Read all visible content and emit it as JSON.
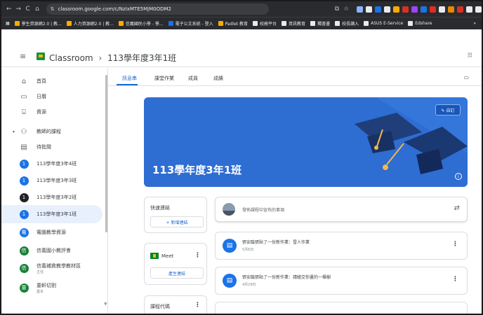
{
  "browser": {
    "url": "classroom.google.com/c/NzIxMTE5MjM0ODM2",
    "nav": {
      "back": "←",
      "forward": "→",
      "reload": "C",
      "home": "⌂",
      "tune": "⇅"
    },
    "star": "☆",
    "screenshot": "⧉",
    "bookmarks": [
      {
        "label": "學生資源網2.0 | 教...",
        "color": "#f9ab00"
      },
      {
        "label": "人力資源網2.0 | 教...",
        "color": "#f9ab00"
      },
      {
        "label": "信義國民小學 - 學...",
        "color": "#f9ab00"
      },
      {
        "label": "電子公文系統 - 登入",
        "color": "#1a73e8"
      },
      {
        "label": "Padlet 教育",
        "color": "#f9ab00"
      },
      {
        "label": "校務平台",
        "color": "#e8eaed"
      },
      {
        "label": "資訊教育",
        "color": "#e8eaed"
      },
      {
        "label": "獨書畫",
        "color": "#e8eaed"
      },
      {
        "label": "校長讀入",
        "color": "#e8eaed"
      },
      {
        "label": "ASUS E-Service",
        "color": "#e8eaed"
      },
      {
        "label": "Edshare",
        "color": "#e8eaed"
      }
    ],
    "more": "»",
    "extension_colors": [
      "#8ab4f8",
      "#e8eaed",
      "#1a73e8",
      "#e8eaed",
      "#f9ab00",
      "#d93025",
      "#a142f4",
      "#1a73e8",
      "#d93025",
      "#e8eaed",
      "#ea8600",
      "#d93025",
      "#e8eaed",
      "#e8eaed"
    ]
  },
  "header": {
    "app_name": "Classroom",
    "separator": "›",
    "class_name": "113學年度3年1班",
    "menu_icon": "≡",
    "apps_icon": "⋮⋮⋮"
  },
  "sidebar": {
    "items": [
      {
        "label": "首頁",
        "icon": "home-icon",
        "glyph": "⌂"
      },
      {
        "label": "日曆",
        "icon": "calendar-icon",
        "glyph": "▭"
      },
      {
        "label": "資源",
        "icon": "resources-icon",
        "glyph": "⌸"
      },
      {
        "label": "教師的課程",
        "icon": "people-icon",
        "glyph": "⚇",
        "caret": "▾"
      },
      {
        "label": "待批閱",
        "icon": "review-icon",
        "glyph": "▤"
      },
      {
        "label": "113學年度3年4班",
        "badge": "1",
        "badge_color": "#1a73e8"
      },
      {
        "label": "113學年度3年3班",
        "badge": "1",
        "badge_color": "#1a73e8"
      },
      {
        "label": "113學年度3年2班",
        "badge": "1",
        "badge_color": "#202124"
      },
      {
        "label": "113學年度3年1班",
        "badge": "1",
        "badge_color": "#1a73e8",
        "active": true
      },
      {
        "label": "電腦教學資源",
        "badge": "電",
        "badge_color": "#1a73e8"
      },
      {
        "label": "信義國小教評會",
        "badge": "信",
        "badge_color": "#188038"
      },
      {
        "label": "信義補救教學教材區",
        "sub": "主任",
        "badge": "信",
        "badge_color": "#188038"
      },
      {
        "label": "童軒切割",
        "sub": "基本",
        "badge": "童",
        "badge_color": "#188038"
      }
    ],
    "scroll_arrow": "▼"
  },
  "tabs": {
    "items": [
      "訊息串",
      "課堂作業",
      "成員",
      "成績"
    ],
    "calendar_icon": "▭"
  },
  "banner": {
    "title": "113學年度3年1班",
    "edit_label": "✎ 自訂",
    "info_icon": "i",
    "color": "#2e6dd2"
  },
  "upcoming": {
    "title": "快速連結",
    "add_button": "+ 新增連結"
  },
  "meet": {
    "title": "Meet",
    "button": "產生連結",
    "kebab": "⋮"
  },
  "class_code": {
    "title": "課程代碼",
    "kebab": "⋮"
  },
  "stream": {
    "announce_placeholder": "發佈課程中宣布的事項",
    "repost_icon": "⇄",
    "posts": [
      {
        "title": "張安臨張貼了一份新作業：雪人作業",
        "date": "5月6日",
        "kebab": "⋮"
      },
      {
        "title": "張安臨張貼了一份新作業：請繪交你畫的一棵樹",
        "date": "4月29日",
        "kebab": "⋮"
      }
    ]
  },
  "colors": {
    "accent": "#1967d2",
    "banner": "#2e6dd2",
    "active_bg": "#e8f0fe"
  }
}
